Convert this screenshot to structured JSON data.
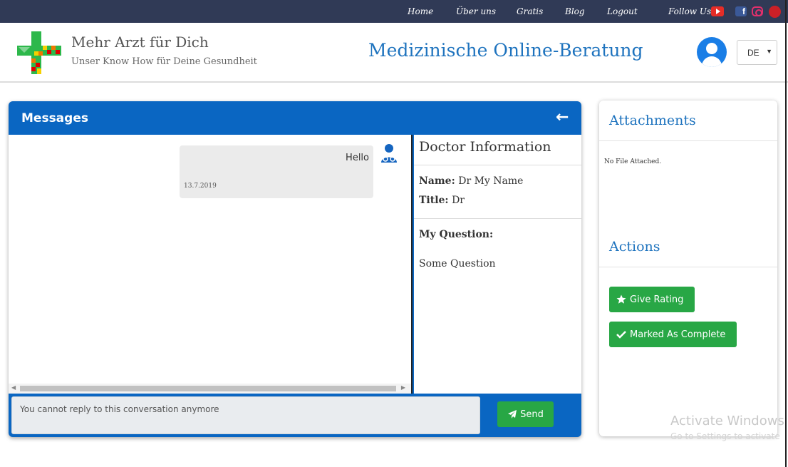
{
  "nav": {
    "home": "Home",
    "about": "Über uns",
    "gratis": "Gratis",
    "blog": "Blog",
    "logout": "Logout",
    "follow": "Follow Us:"
  },
  "social": [
    "youtube-icon",
    "facebook-icon",
    "instagram-icon",
    "pinterest-icon"
  ],
  "header": {
    "brand_title": "Mehr Arzt für Dich",
    "brand_subtitle": "Unser Know How für Deine Gesundheit",
    "site_title": "Medizinische Online-Beratung",
    "language": "DE"
  },
  "messages": {
    "title": "Messages",
    "items": [
      {
        "text": "Hello",
        "date": "13.7.2019"
      }
    ],
    "reply_placeholder": "You cannot reply to this conversation anymore",
    "send_label": "Send"
  },
  "doctor": {
    "title": "Doctor Information",
    "name_label": "Name:",
    "name_value": "Dr My Name",
    "title_label": "Title:",
    "title_value": "Dr",
    "question_label": "My Question:",
    "question_value": "Some Question"
  },
  "sidebar": {
    "attachments_title": "Attachments",
    "no_file": "No File Attached.",
    "actions_title": "Actions",
    "rating_label": "Give Rating",
    "complete_label": "Marked As Complete"
  },
  "watermark": {
    "line1": "Activate Windows",
    "line2": "Go to Settings to activate"
  },
  "colors": {
    "topbar": "#303a56",
    "primary": "#0a66c2",
    "accent_green": "#28a745",
    "title_blue": "#1e73be"
  }
}
